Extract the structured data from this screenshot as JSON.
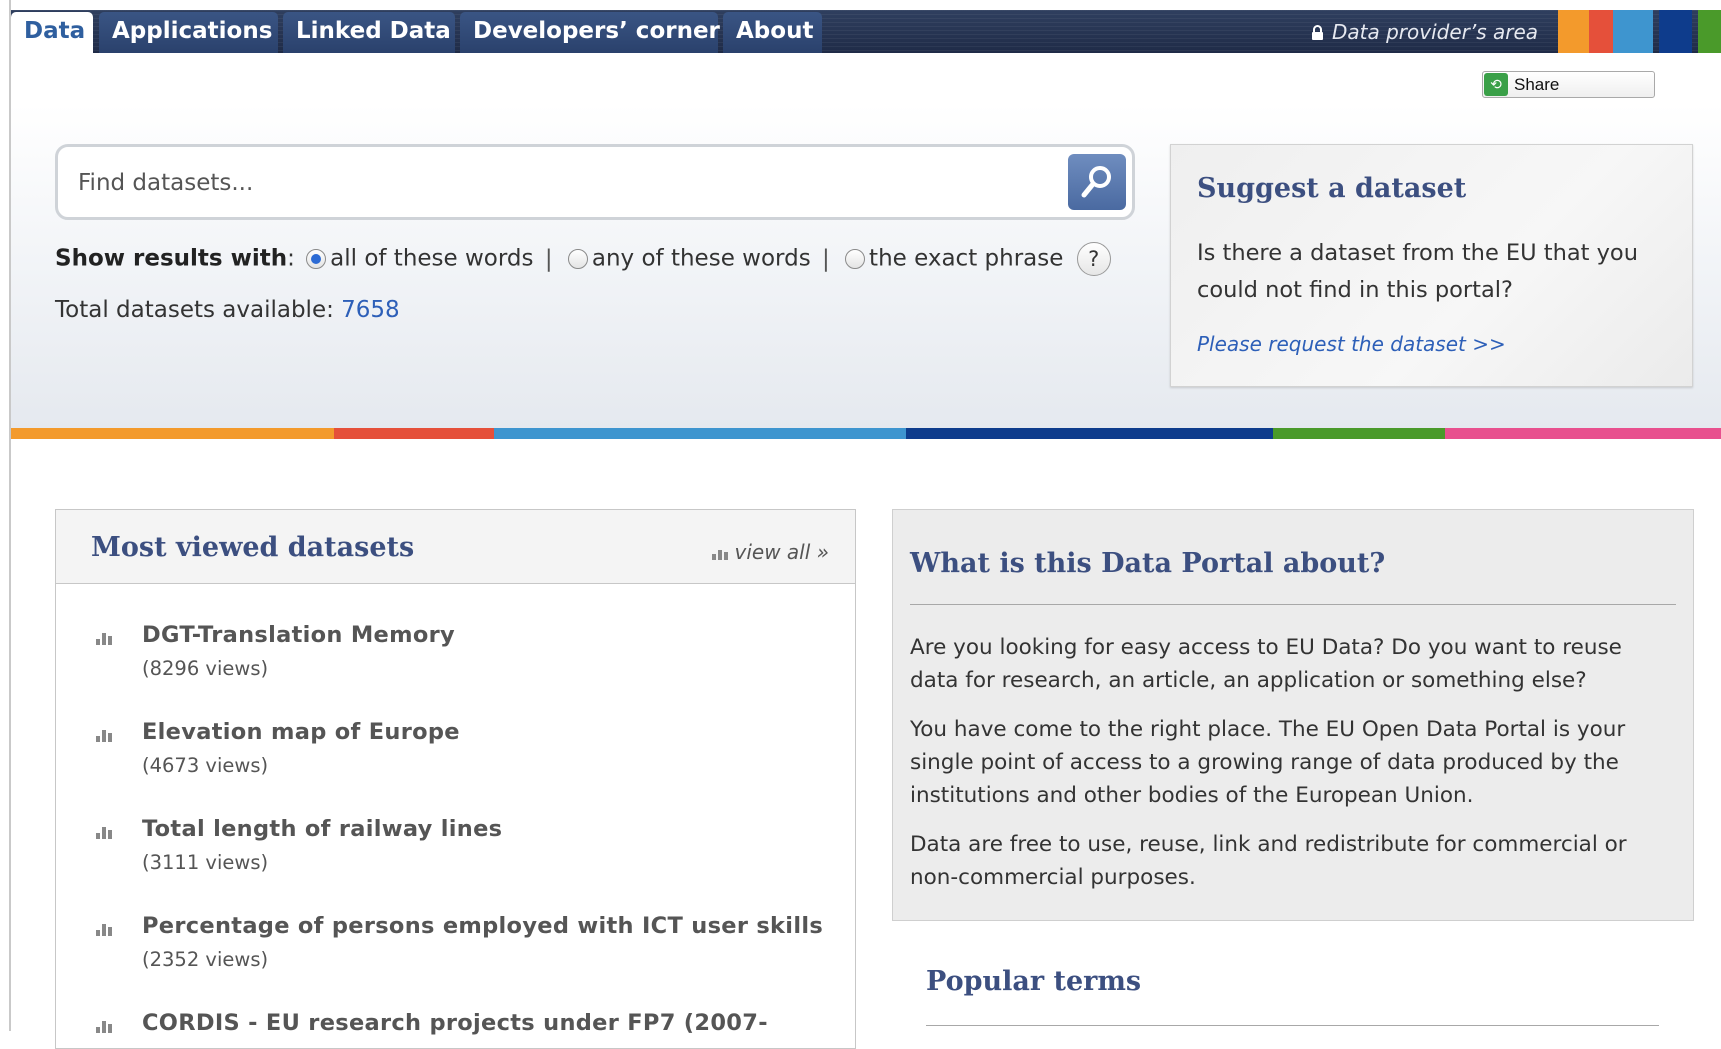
{
  "nav": {
    "tabs": [
      {
        "label": "Data",
        "active": true
      },
      {
        "label": "Applications",
        "active": false
      },
      {
        "label": "Linked Data",
        "active": false
      },
      {
        "label": "Developers’ corner",
        "active": false
      },
      {
        "label": "About",
        "active": false
      }
    ],
    "provider_area": "Data provider’s area",
    "stripe_colors": [
      "#f39a2c",
      "#e5503a",
      "#3e95cf",
      "#0e3c8c",
      "#4a9a2a"
    ]
  },
  "share": {
    "label": "Share",
    "icon": "share-icon"
  },
  "search": {
    "placeholder": "Find datasets...",
    "button_icon": "search-icon",
    "options_label": "Show results with",
    "options": [
      "all of these words",
      "any of these words",
      "the exact phrase"
    ],
    "selected_option": "all of these words",
    "help": "?"
  },
  "total": {
    "label": "Total datasets available:",
    "value": "7658"
  },
  "suggest": {
    "title": "Suggest a dataset",
    "text": "Is there a dataset from the EU that you could not find in this portal?",
    "link": "Please request the dataset >>"
  },
  "colorbar": [
    "#f39a2c",
    "#e5503a",
    "#3e95cf",
    "#0e3c8c",
    "#4a9a2a",
    "#e8508e"
  ],
  "most_viewed": {
    "title": "Most viewed datasets",
    "view_all": "view all »",
    "items": [
      {
        "name": "DGT-Translation Memory",
        "views": "(8296 views)"
      },
      {
        "name": "Elevation map of Europe",
        "views": "(4673 views)"
      },
      {
        "name": "Total length of railway lines",
        "views": "(3111 views)"
      },
      {
        "name": "Percentage of persons employed with ICT user skills",
        "views": "(2352 views)"
      },
      {
        "name": "CORDIS - EU research projects under FP7 (2007-",
        "views": ""
      }
    ]
  },
  "about": {
    "title": "What is this Data Portal about?",
    "paragraphs": [
      "Are you looking for easy access to EU Data? Do you want to reuse data for research, an article, an application or something else?",
      "You have come to the right place. The EU Open Data Portal is your single point of access to a growing range of data produced by the institutions and other bodies of the European Union.",
      "Data are free to use, reuse, link and redistribute for commercial or non-commercial purposes."
    ]
  },
  "popular_terms": {
    "title": "Popular terms"
  }
}
